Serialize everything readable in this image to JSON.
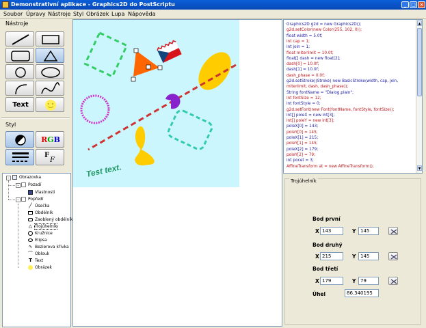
{
  "window": {
    "title": "Demonstrativní aplikace - Graphics2D do PostScriptu",
    "buttons": {
      "minimize": "_",
      "maximize": "□",
      "close": "×"
    }
  },
  "menu": [
    "Soubor",
    "Úpravy",
    "Nástroje",
    "Styl",
    "Obrázek",
    "Lupa",
    "Nápověda"
  ],
  "tools": {
    "title": "Nástroje",
    "text_button": "Text",
    "items": [
      "line",
      "rectangle",
      "rounded-rectangle",
      "triangle",
      "circle",
      "ellipse",
      "arc",
      "bezier-curve",
      "text",
      "image"
    ]
  },
  "style": {
    "title": "Styl",
    "rgb_label": "RGB",
    "font_label": "F",
    "font_label2": "F"
  },
  "tree": {
    "items": [
      {
        "label": "Obrazovka",
        "level": 0
      },
      {
        "label": "Pozadí",
        "level": 1
      },
      {
        "label": "Vlastnosti",
        "level": 2
      },
      {
        "label": "Popředí",
        "level": 1
      },
      {
        "label": "Úsečka",
        "level": 2
      },
      {
        "label": "Obdélník",
        "level": 2
      },
      {
        "label": "Zaoblený obdélník",
        "level": 2
      },
      {
        "label": "Trojúhelník",
        "level": 2,
        "selected": true
      },
      {
        "label": "Kružnice",
        "level": 2
      },
      {
        "label": "Elipsa",
        "level": 2
      },
      {
        "label": "Bezierova křivka",
        "level": 2
      },
      {
        "label": "Oblouk",
        "level": 2
      },
      {
        "label": "Text",
        "level": 2
      },
      {
        "label": "Obrázek",
        "level": 2
      }
    ]
  },
  "canvas": {
    "background": "#ccf6fd",
    "sample_text": "Test text."
  },
  "code": {
    "lines": [
      "Graphics2D g2d = new Graphics2D();",
      "g2d.setColor(new Color(255, 102, 0));",
      "float width = 5.0f;",
      "int cap = 1;",
      "int join = 1;",
      "float miterlimit = 10.0f;",
      "float[] dash = new float[2];",
      "dash[0] = 10.0f;",
      "dash[1] = 10.0f;",
      "dash_phase = 0.0f;",
      "g2d.setStroke((Stroke) new BasicStroke(width, cap, join,",
      "miterlimit, dash, dash_phase));",
      "String fontName = \"Dialog.plain\";",
      "int fontSize = 12;",
      "int fontStyle = 0;",
      "g2d.setFont(new Font(fontName, fontStyle, fontSize));",
      "int[] poleX = new int[3];",
      "int[] poleY = new int[3];",
      "poleX[0] = 143;",
      "poleY[0] = 145;",
      "poleX[1] = 215;",
      "poleY[1] = 145;",
      "poleX[2] = 179;",
      "poleY[2] = 79;",
      "int pocet = 3;",
      "AffineTransform at = new AffineTransform();"
    ]
  },
  "properties": {
    "title": "Trojúhelník",
    "x_label": "X",
    "y_label": "Y",
    "points": [
      {
        "label": "Bod první",
        "x": "143",
        "y": "145"
      },
      {
        "label": "Bod druhý",
        "x": "215",
        "y": "145"
      },
      {
        "label": "Bod třetí",
        "x": "179",
        "y": "79"
      }
    ],
    "angle_label": "Úhel",
    "angle_value": "86.340195"
  },
  "colors": {
    "accent_orange": "#ff6600",
    "dash_green": "#33cc66",
    "dash_red": "#cc3333",
    "circle_magenta": "#cc33cc",
    "ellipse_yellow": "#ffcc00",
    "teal": "#33ccaa"
  }
}
